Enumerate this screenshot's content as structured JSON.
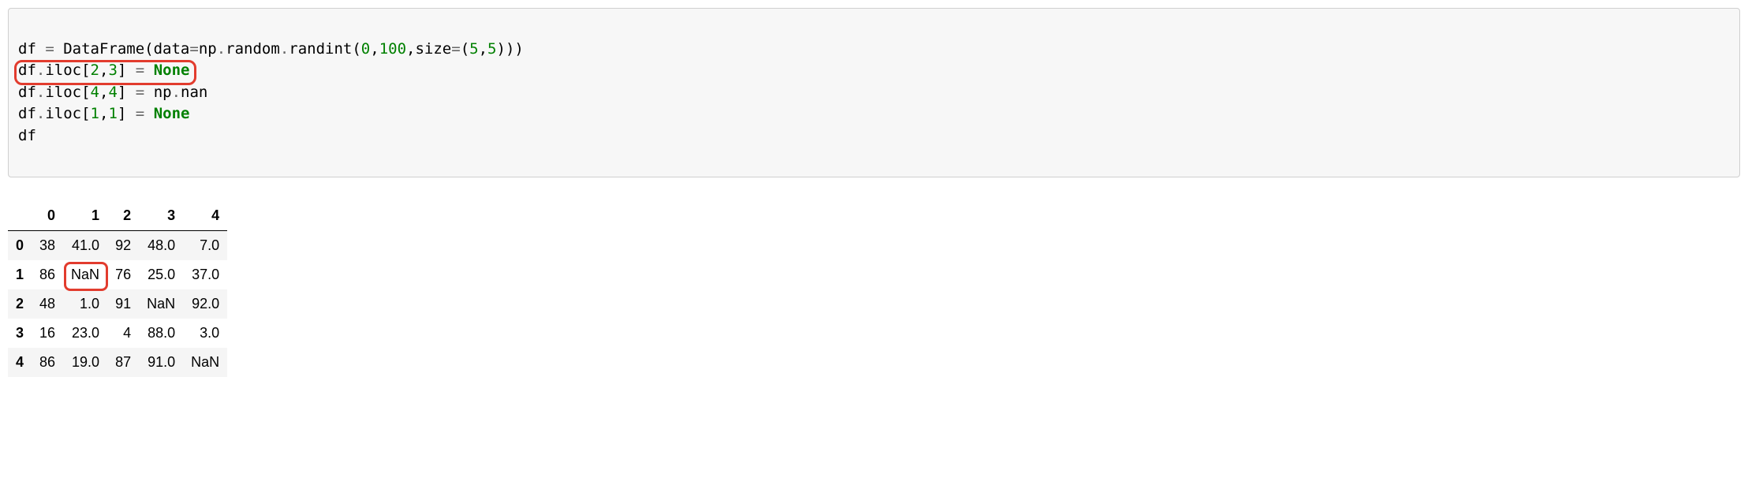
{
  "code": {
    "l1": {
      "a": "df ",
      "op1": "=",
      "b": " DataFrame(data",
      "op2": "=",
      "c": "np",
      "dot1": ".",
      "d": "random",
      "dot2": ".",
      "e": "randint(",
      "n1": "0",
      "comma1": ",",
      "n2": "100",
      "comma2": ",",
      "f": "size",
      "op3": "=",
      "g": "(",
      "n3": "5",
      "comma3": ",",
      "n4": "5",
      "h": ")))"
    },
    "l2": {
      "a": "df",
      "dot": ".",
      "b": "iloc[",
      "n1": "2",
      "comma": ",",
      "n2": "3",
      "c": "] ",
      "op": "=",
      "sp": " ",
      "kw": "None"
    },
    "l3": {
      "a": "df",
      "dot": ".",
      "b": "iloc[",
      "n1": "4",
      "comma": ",",
      "n2": "4",
      "c": "] ",
      "op": "=",
      "sp": " np",
      "dot2": ".",
      "d": "nan"
    },
    "l4": {
      "a": "df",
      "dot": ".",
      "b": "iloc[",
      "n1": "1",
      "comma": ",",
      "n2": "1",
      "c": "] ",
      "op": "=",
      "sp": " ",
      "kw": "None"
    },
    "l5": {
      "a": "df"
    }
  },
  "table": {
    "columns": [
      "0",
      "1",
      "2",
      "3",
      "4"
    ],
    "index": [
      "0",
      "1",
      "2",
      "3",
      "4"
    ],
    "rows": [
      [
        "38",
        "41.0",
        "92",
        "48.0",
        "7.0"
      ],
      [
        "86",
        "NaN",
        "76",
        "25.0",
        "37.0"
      ],
      [
        "48",
        "1.0",
        "91",
        "NaN",
        "92.0"
      ],
      [
        "16",
        "23.0",
        "4",
        "88.0",
        "3.0"
      ],
      [
        "86",
        "19.0",
        "87",
        "91.0",
        "NaN"
      ]
    ]
  },
  "annotations": {
    "code_highlight": {
      "line": 2
    },
    "cell_highlight": {
      "row": 1,
      "col": 1
    }
  }
}
